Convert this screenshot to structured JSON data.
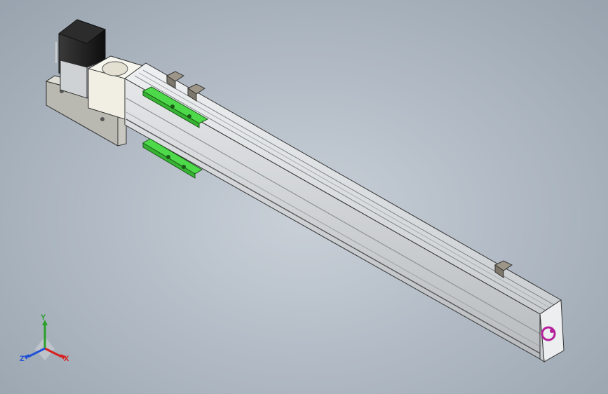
{
  "viewport": {
    "background_center": "#c9d0d8",
    "background_edge": "#98a3ae"
  },
  "model": {
    "type": "linear-module-actuator",
    "profile_color": "#d9dcde",
    "profile_shade": "#b7bbbe",
    "slider_color": "#4ed94a",
    "motor_color": "#1e1e1e",
    "mount_block_color": "#cfcfc8",
    "coupling_color": "#f2f0e6",
    "end_cap_logo_color": "#b51e9b",
    "sensors": [
      "limit-sensor-left",
      "limit-sensor-center",
      "limit-sensor-right"
    ]
  },
  "triad": {
    "x_label": "X",
    "y_label": "Y",
    "z_label": "Z",
    "x_color": "#d62020",
    "y_color": "#2aa02a",
    "z_color": "#2050d6"
  }
}
